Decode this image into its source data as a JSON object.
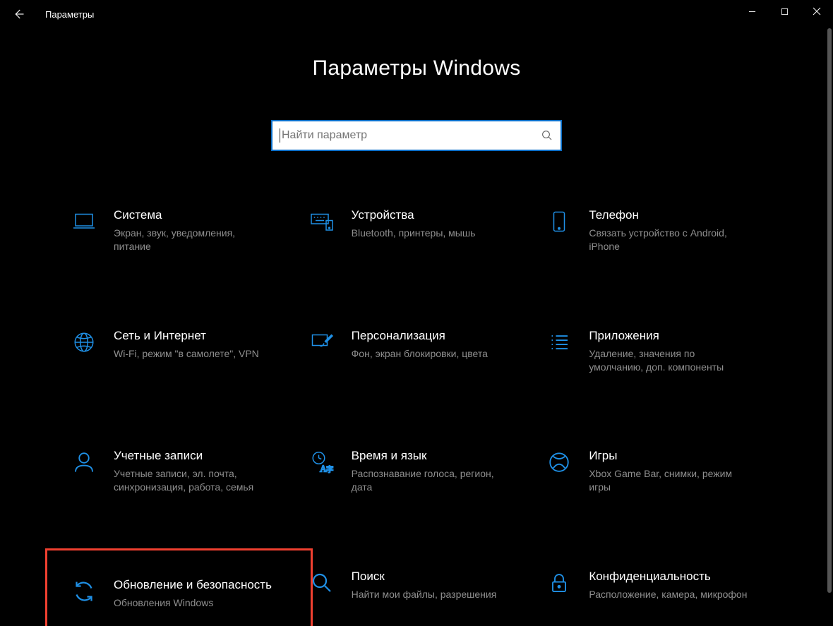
{
  "window": {
    "back_label": "Назад",
    "title": "Параметры",
    "minimize": "Свернуть",
    "maximize": "Развернуть",
    "close": "Закрыть"
  },
  "page_heading": "Параметры Windows",
  "search": {
    "placeholder": "Найти параметр"
  },
  "tiles": [
    {
      "id": "system",
      "icon": "laptop-icon",
      "title": "Система",
      "desc": "Экран, звук, уведомления, питание"
    },
    {
      "id": "devices",
      "icon": "keyboard-icon",
      "title": "Устройства",
      "desc": "Bluetooth, принтеры, мышь"
    },
    {
      "id": "phone",
      "icon": "phone-icon",
      "title": "Телефон",
      "desc": "Связать устройство с Android, iPhone"
    },
    {
      "id": "network",
      "icon": "globe-icon",
      "title": "Сеть и Интернет",
      "desc": "Wi-Fi, режим \"в самолете\", VPN"
    },
    {
      "id": "personalize",
      "icon": "brush-icon",
      "title": "Персонализация",
      "desc": "Фон, экран блокировки, цвета"
    },
    {
      "id": "apps",
      "icon": "apps-icon",
      "title": "Приложения",
      "desc": "Удаление, значения по умолчанию, доп. компоненты"
    },
    {
      "id": "accounts",
      "icon": "person-icon",
      "title": "Учетные записи",
      "desc": "Учетные записи, эл. почта, синхронизация, работа, семья"
    },
    {
      "id": "time-lang",
      "icon": "time-lang-icon",
      "title": "Время и язык",
      "desc": "Распознавание голоса, регион, дата"
    },
    {
      "id": "gaming",
      "icon": "xbox-icon",
      "title": "Игры",
      "desc": "Xbox Game Bar, снимки, режим игры"
    },
    {
      "id": "update",
      "icon": "sync-icon",
      "title": "Обновление и безопасность",
      "desc": "Обновления Windows",
      "highlight": true
    },
    {
      "id": "search",
      "icon": "search-icon",
      "title": "Поиск",
      "desc": "Найти мои файлы, разрешения"
    },
    {
      "id": "privacy",
      "icon": "lock-icon",
      "title": "Конфиденциальность",
      "desc": "Расположение, камера, микрофон"
    }
  ]
}
